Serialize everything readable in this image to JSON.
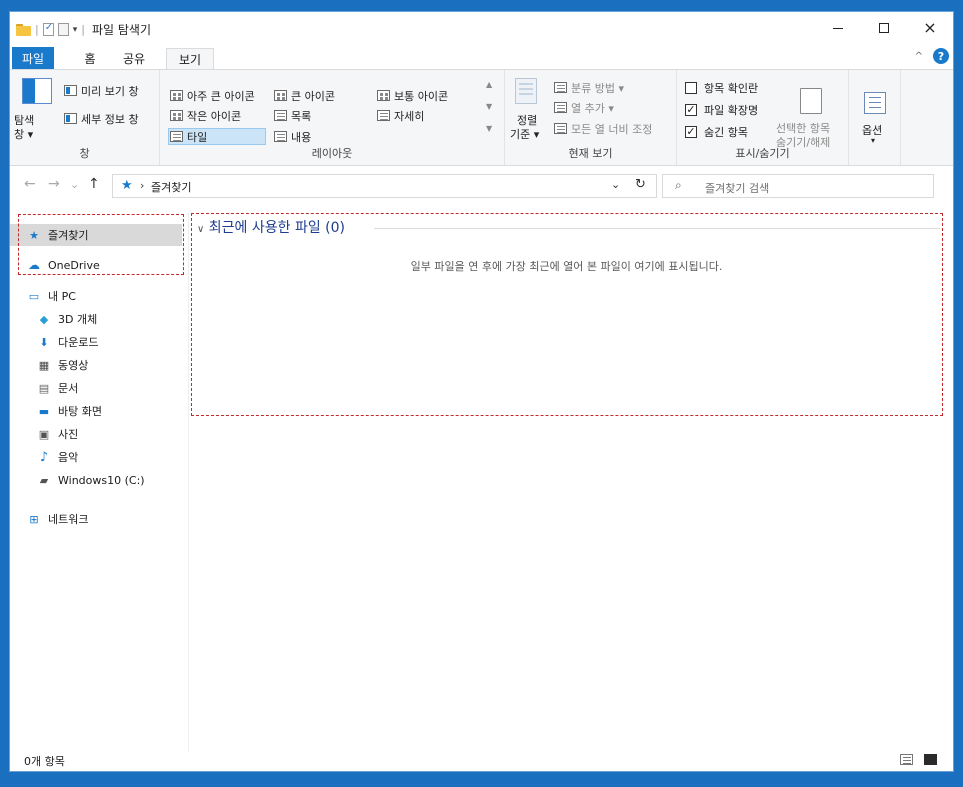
{
  "title_bar": {
    "title": "파일 탐색기",
    "separator": "|",
    "dropdown_glyph": "▾",
    "controls": {
      "minimize": "minimize",
      "maximize": "maximize",
      "close": "×"
    }
  },
  "ribbon_tabs": [
    {
      "label": "파일",
      "active": false
    },
    {
      "label": "홈",
      "active": false
    },
    {
      "label": "공유",
      "active": false
    },
    {
      "label": "보기",
      "active": true
    }
  ],
  "ribbon_right": {
    "collapse": "^",
    "help": "?"
  },
  "ribbon": {
    "pane_group": {
      "label": "창",
      "nav_pane": "탐색\n창 ▾",
      "nav_pane_line1": "탐색",
      "nav_pane_line2": "창 ▾",
      "preview": "미리 보기 창",
      "details": "세부 정보 창"
    },
    "layout_group": {
      "label": "레이아웃",
      "items": [
        "아주 큰 아이콘",
        "큰 아이콘",
        "보통 아이콘",
        "작은 아이콘",
        "목록",
        "자세히",
        "타일",
        "내용"
      ],
      "selected": "타일"
    },
    "current_view_group": {
      "label": "현재 보기",
      "sort_line1": "정렬",
      "sort_line2": "기준 ▾",
      "group_by": "분류 방법 ▾",
      "add_columns": "열 추가 ▾",
      "size_columns": "모든 열 너비 조정"
    },
    "show_hide_group": {
      "label": "표시/숨기기",
      "item_checkboxes": {
        "label": "항목 확인란",
        "checked": false
      },
      "file_extensions": {
        "label": "파일 확장명",
        "checked": true
      },
      "hidden_items": {
        "label": "숨긴 항목",
        "checked": true
      },
      "hide_selected_line1": "선택한 항목",
      "hide_selected_line2": "숨기기/해제"
    },
    "options": {
      "label": "옵션",
      "caret": "▾"
    }
  },
  "nav": {
    "back": "←",
    "forward": "→",
    "recent": "⌄",
    "up": "↑",
    "breadcrumb_sep": "›",
    "address": "즐겨찾기",
    "address_drop": "⌄",
    "refresh": "↻",
    "search_placeholder": "즐겨찾기 검색"
  },
  "nav_pane": {
    "items": [
      {
        "label": "즐겨찾기",
        "icon": "star-icon",
        "selected": true
      },
      {
        "label": "OneDrive",
        "icon": "cloud-icon"
      },
      {
        "label": "내 PC",
        "icon": "computer-icon"
      },
      {
        "label": "3D 개체",
        "icon": "cube-icon"
      },
      {
        "label": "다운로드",
        "icon": "download-arrow-icon"
      },
      {
        "label": "동영상",
        "icon": "film-icon"
      },
      {
        "label": "문서",
        "icon": "document-icon"
      },
      {
        "label": "바탕 화면",
        "icon": "desktop-icon"
      },
      {
        "label": "사진",
        "icon": "picture-icon"
      },
      {
        "label": "음악",
        "icon": "music-note-icon"
      },
      {
        "label": "Windows10 (C:)",
        "icon": "drive-icon"
      },
      {
        "label": "네트워크",
        "icon": "network-icon"
      }
    ]
  },
  "content": {
    "section_caret": "∨",
    "section_title": "최근에 사용한 파일 (0)",
    "empty_message": "일부 파일을 연 후에 가장 최근에 열어 본 파일이 여기에 표시됩니다."
  },
  "status_bar": {
    "item_count": "0개 항목"
  },
  "colors": {
    "accent": "#1979ca",
    "section_title": "#1e3d8f",
    "annotation_dash": "#c02a2a"
  }
}
